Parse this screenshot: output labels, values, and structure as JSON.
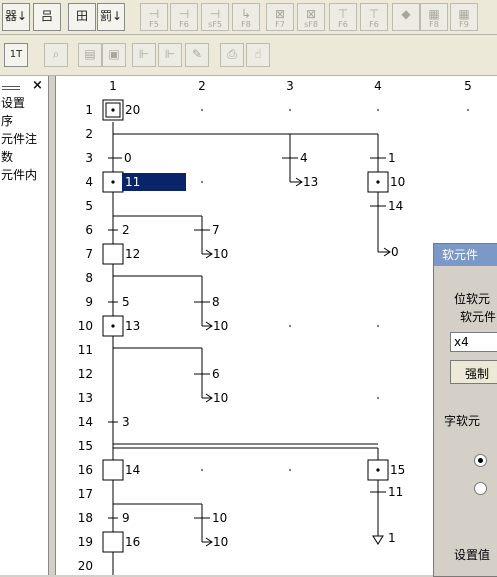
{
  "toolbar_top": {
    "buttons": [
      {
        "name": "device-toggle-button",
        "glyph": "器↓"
      },
      {
        "name": "ladder-view-button",
        "glyph": "吕"
      },
      {
        "name": "table-view-button",
        "glyph": "田"
      },
      {
        "name": "sort-button",
        "glyph": "罰↓"
      }
    ],
    "fkeys": [
      "F5",
      "F6",
      "sF5",
      "F8",
      "F7",
      "sF8",
      "F6",
      "F6"
    ],
    "fkeys_right": [
      "F8",
      "F9"
    ]
  },
  "toolbar_second": {
    "buttons": [
      "1T",
      "S",
      "pg",
      "cp",
      "lm",
      "lm",
      "pr",
      "rd"
    ]
  },
  "sidebar": {
    "close_label": "×",
    "items": [
      "设置",
      "序",
      "元件注",
      "数",
      "元件内"
    ]
  },
  "sfc": {
    "columns": [
      "1",
      "2",
      "3",
      "4",
      "5"
    ],
    "rows": [
      "1",
      "2",
      "3",
      "4",
      "5",
      "6",
      "7",
      "8",
      "9",
      "10",
      "11",
      "12",
      "13",
      "14",
      "15",
      "16",
      "17",
      "18",
      "19",
      "20"
    ],
    "steps": [
      {
        "label": "20"
      },
      {
        "label": "11"
      },
      {
        "label": "10"
      },
      {
        "label": "12"
      },
      {
        "label": "13"
      },
      {
        "label": "14"
      },
      {
        "label": "15"
      },
      {
        "label": "16"
      }
    ],
    "transitions": [
      {
        "label": "0"
      },
      {
        "label": "4"
      },
      {
        "label": "1"
      },
      {
        "label": "14"
      },
      {
        "label": "2"
      },
      {
        "label": "7"
      },
      {
        "label": "5"
      },
      {
        "label": "8"
      },
      {
        "label": "6"
      },
      {
        "label": "3"
      },
      {
        "label": "11"
      },
      {
        "label": "9"
      },
      {
        "label": "10"
      }
    ],
    "jumps": [
      {
        "label": "13"
      },
      {
        "label": "10"
      },
      {
        "label": "0"
      },
      {
        "label": "10"
      },
      {
        "label": "10"
      },
      {
        "label": "10"
      },
      {
        "label": "10"
      }
    ],
    "resets": [
      {
        "label": "1"
      }
    ]
  },
  "dialog": {
    "title": "软元件",
    "group_bit": "位软元",
    "label_device": "软元件",
    "input_value": "x4",
    "force_button": "强制",
    "group_word": "字软元",
    "status_text": "设置值"
  }
}
